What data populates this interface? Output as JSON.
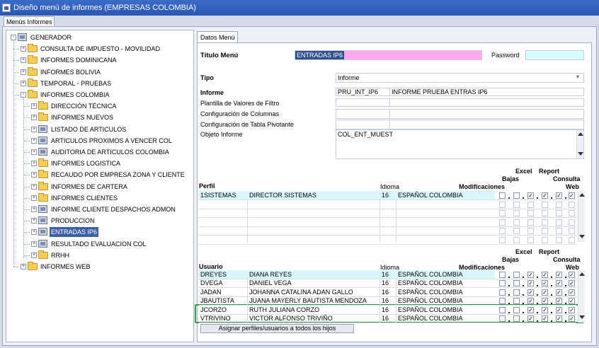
{
  "window": {
    "title": "Diseño menú de informes (EMPRESAS COLOMBIA)"
  },
  "tabs": {
    "left": "Menús Informes",
    "right": "Datos Menú"
  },
  "tree": [
    {
      "label": "GENERADOR",
      "type": "comp",
      "level": 0,
      "exp": "-"
    },
    {
      "label": "CONSULTA DE IMPUESTO - MOVILIDAD",
      "type": "folder",
      "level": 1,
      "exp": "+"
    },
    {
      "label": "INFORMES DOMINICANA",
      "type": "folder",
      "level": 1,
      "exp": "+"
    },
    {
      "label": "INFORMES BOLIVIA",
      "type": "folder",
      "level": 1,
      "exp": "+"
    },
    {
      "label": "TEMPORAL - PRUEBAS",
      "type": "folder",
      "level": 1,
      "exp": "+"
    },
    {
      "label": "INFORMES COLOMBIA",
      "type": "folder",
      "level": 1,
      "exp": "-"
    },
    {
      "label": "DIRECCIÓN TÉCNICA",
      "type": "folder",
      "level": 2,
      "exp": "+"
    },
    {
      "label": "INFORMES NUEVOS",
      "type": "folder",
      "level": 2,
      "exp": "+"
    },
    {
      "label": "LISTADO DE ARTICULOS",
      "type": "comp",
      "level": 2,
      "exp": "+"
    },
    {
      "label": "ARTICULOS PROXIMOS A VENCER COL",
      "type": "comp",
      "level": 2,
      "exp": "+"
    },
    {
      "label": "AUDITORIA DE ARTICULOS COLOMBIA",
      "type": "comp",
      "level": 2,
      "exp": "+"
    },
    {
      "label": "INFORMES LOGISTICA",
      "type": "folder",
      "level": 2,
      "exp": "+"
    },
    {
      "label": "RECAUDO POR EMPRESA ZONA Y CLIENTE",
      "type": "folder",
      "level": 2,
      "exp": "+"
    },
    {
      "label": "INFORMES DE CARTERA",
      "type": "folder",
      "level": 2,
      "exp": "+"
    },
    {
      "label": "INFORMES CLIENTES",
      "type": "folder",
      "level": 2,
      "exp": "+"
    },
    {
      "label": "INFORME CLIENTE DESPACHOS ADMON",
      "type": "comp",
      "level": 2,
      "exp": "+"
    },
    {
      "label": "PRODUCCION",
      "type": "comp",
      "level": 2,
      "exp": "+"
    },
    {
      "label": "ENTRADAS IP6",
      "type": "comp",
      "level": 2,
      "exp": "+",
      "selected": true
    },
    {
      "label": "RESULTADO EVALUACION COL",
      "type": "comp",
      "level": 2,
      "exp": "+"
    },
    {
      "label": "RRHH",
      "type": "folder",
      "level": 2,
      "exp": "+"
    },
    {
      "label": "INFORMES WEB",
      "type": "folder",
      "level": 1,
      "exp": "+"
    }
  ],
  "form": {
    "titulo_label": "Título Menú",
    "titulo_value": "ENTRADAS IP6",
    "password_label": "Password",
    "password_value": "",
    "tipo_label": "Tipo",
    "tipo_value": "Informe",
    "informe_label": "Informe",
    "informe_code": "PRU_INT_IP6",
    "informe_name": "INFORME PRUEBA ENTRAS IP6",
    "plantilla_label": "Plantilla de Valores de Filtro",
    "config_cols_label": "Configuración de Columnas",
    "config_pivot_label": "Configuración de Tabla Pivotante",
    "objeto_label": "Objeto Informe",
    "objeto_value": "COL_ENT_MUEST"
  },
  "headers": {
    "idioma": "Idioma",
    "modificaciones": "Modificaciones",
    "bajas": "Bajas",
    "excel": "Excel",
    "report": "Report",
    "consulta": "Consulta",
    "web": "Web"
  },
  "perfiles": {
    "title": "Perfil",
    "rows": [
      {
        "code": "1SISTEMAS",
        "name": "DIRECTOR SISTEMAS",
        "lang_id": "16",
        "lang": "ESPAÑOL COLOMBIA",
        "checks": [
          false,
          false,
          true,
          true,
          true,
          true
        ]
      }
    ],
    "empty_rows": 5
  },
  "usuarios": {
    "title": "Usuario",
    "rows": [
      {
        "code": "DREYES",
        "name": "DIANA REYES",
        "lang_id": "16",
        "lang": "ESPAÑOL COLOMBIA",
        "checks": [
          false,
          false,
          true,
          true,
          true,
          true
        ]
      },
      {
        "code": "DVEGA",
        "name": "DANIEL VEGA",
        "lang_id": "16",
        "lang": "ESPAÑOL COLOMBIA",
        "checks": [
          false,
          false,
          true,
          true,
          true,
          true
        ]
      },
      {
        "code": "JADAN",
        "name": "JOHANNA CATALINA ADAN GALLO",
        "lang_id": "16",
        "lang": "ESPAÑOL COLOMBIA",
        "checks": [
          false,
          false,
          true,
          true,
          true,
          true
        ]
      },
      {
        "code": "JBAUTISTA",
        "name": "JUANA MAYERLY BAUTISTA MENDOZA",
        "lang_id": "16",
        "lang": "ESPAÑOL COLOMBIA",
        "checks": [
          false,
          false,
          true,
          true,
          true,
          true
        ]
      },
      {
        "code": "JCORZO",
        "name": "RUTH JULIANA CORZO",
        "lang_id": "16",
        "lang": "ESPAÑOL COLOMBIA",
        "checks": [
          false,
          false,
          true,
          true,
          true,
          true
        ]
      },
      {
        "code": "VTRIVINO",
        "name": "VICTOR ALFONSO TRIVIÑO",
        "lang_id": "16",
        "lang": "ESPAÑOL COLOMBIA",
        "checks": [
          false,
          false,
          true,
          true,
          true,
          true
        ]
      }
    ]
  },
  "assign_button": "Asignar perfiles/usuarios a todos los hijos",
  "colors": {
    "title_bg": "#2a57b3",
    "selected": "#3c5fa5",
    "pink_field": "#ffa8f0",
    "cyan_field": "#d8fbff",
    "row_highlight": "#d9f7fb",
    "green_box": "#2ea04a"
  },
  "icons": {
    "folder": "folder-icon",
    "comp": "report-node-icon",
    "check": "checkmark-icon"
  }
}
